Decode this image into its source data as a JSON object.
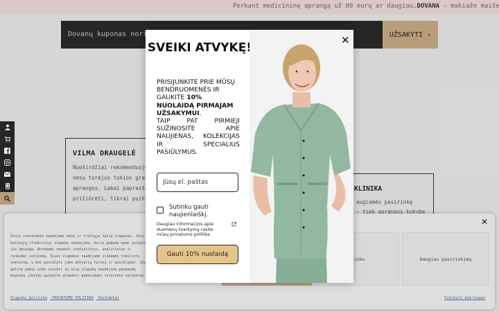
{
  "topbar": {
    "prefix": "Perkant medicininę aprangą už 80 eurų ar daugiau,",
    "bold": "DOVANA",
    "suffix": " - makiažo maišelis. Galioja iki"
  },
  "coupon": {
    "text": "Dovanų kuponas norima",
    "button_label": "UŽSAKYTI",
    "button_arrow": "›"
  },
  "sidebar": {
    "icons": [
      "user-icon",
      "cart-icon",
      "facebook-icon",
      "instagram-icon",
      "mail-icon",
      "phone-icon",
      "search-icon"
    ],
    "glyphs": [
      "●",
      "▲",
      "f",
      "◎",
      "✉",
      "▯",
      "⌕"
    ]
  },
  "reviews": [
    {
      "name": "VILMA DRAUGELĖ",
      "lines": [
        "Nuoširdžiai rekomenduoju !",
        "nesu turėjus tokios gražio",
        "aprangos. Labai paprasta",
        "prižiūrėti, tikrai puiki ko"
      ]
    },
    {
      "name": "KLINIKA",
      "lines": [
        "augiamės pasirinkę",
        "- tiek aprangos kokybe"
      ]
    }
  ],
  "cookie": {
    "text": "Šioje svetainėje naudojami mūsų ir trečiųjų šalių slapukai. Jūsų būtinųjų (funkcinių) slapukų naudojimo, kurie padeda mums valdyti jūs apsauga. Norėdami naudoti statistinius, analitinius ir rinkodar sutikimą. Šiuos slapukus naudojame siekdami tobulinti svetainę, u bei pasiūlyti jums aktualių turinį ir pasiūlymus. Jūs galite pakei arba sutikti su visų slapukų naudojimu paspaudę mygtuką „Sutiku galėsite atšaukti pakeisdami interneto naršyklės nustatymus ir iš",
    "close": "✕",
    "btn_decline": "Sutinku",
    "btn_more": "Daugiau pasirinkimų",
    "links": [
      "Slapukų politika",
      "PRIVATUMO POLITIKA",
      "Kontaktai"
    ],
    "right_link": "Tvarkyti paslaugas"
  },
  "modal": {
    "title": "SVEIKI ATVYKĘ!",
    "body_part1": "PRISIJUNKITE PRIE MŪSŲ BENDRUOMENĖS IR GAUKITE ",
    "body_bold": "10% NUOLAIDĄ PIRMAJAM UŽSAKYMUI",
    "body_part1_end": ".",
    "body_part2": "TAIP PAT PIRMIEJI SUŽINOSITE APIE NAUJIENAS, KOLEKCIJAS IR SPECIALIUS PASIŪLYMUS.",
    "email_placeholder": "Jūsų el. paštas",
    "checkbox_label": "Sutinku gauti naujienlaiškį.",
    "privacy_text": "Daugiau informacijos apie duomenų tvarkymą rasite mūsų privatumo politika",
    "submit_label": "Gauti 10% nuolaidą",
    "close": "✕"
  },
  "colors": {
    "accent_gold": "#c7ac83",
    "button_gold": "#e5c487",
    "scrub_green": "#93b8a2",
    "banner_pink": "#efd8dc"
  }
}
